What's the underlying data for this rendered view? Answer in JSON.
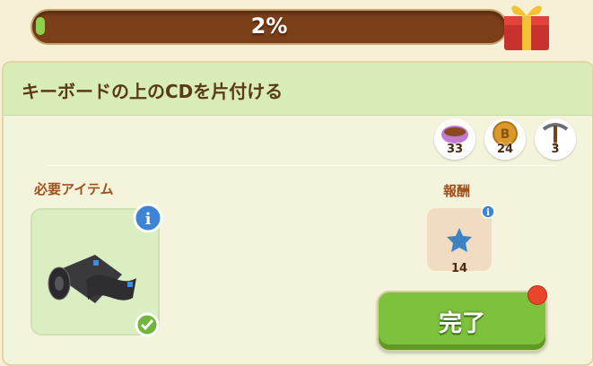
{
  "progress": {
    "label": "2%",
    "value": 0.02
  },
  "task": {
    "title": "キーボードの上のCDを片付ける"
  },
  "resources": [
    {
      "icon": "tea-cup-icon",
      "count": "33"
    },
    {
      "icon": "coin-icon",
      "count": "24"
    },
    {
      "icon": "pickaxe-icon",
      "count": "3"
    }
  ],
  "required": {
    "label": "必要アイテム",
    "item_icon": "cd-stack-icon",
    "status_icon": "check-icon"
  },
  "reward": {
    "label": "報酬",
    "icon": "blue-star-icon",
    "count": "14"
  },
  "complete_button": {
    "label": "完了"
  },
  "colors": {
    "accent_green": "#7ec13c",
    "bar_brown": "#7b3f1a",
    "header_green": "#d9edb9"
  }
}
